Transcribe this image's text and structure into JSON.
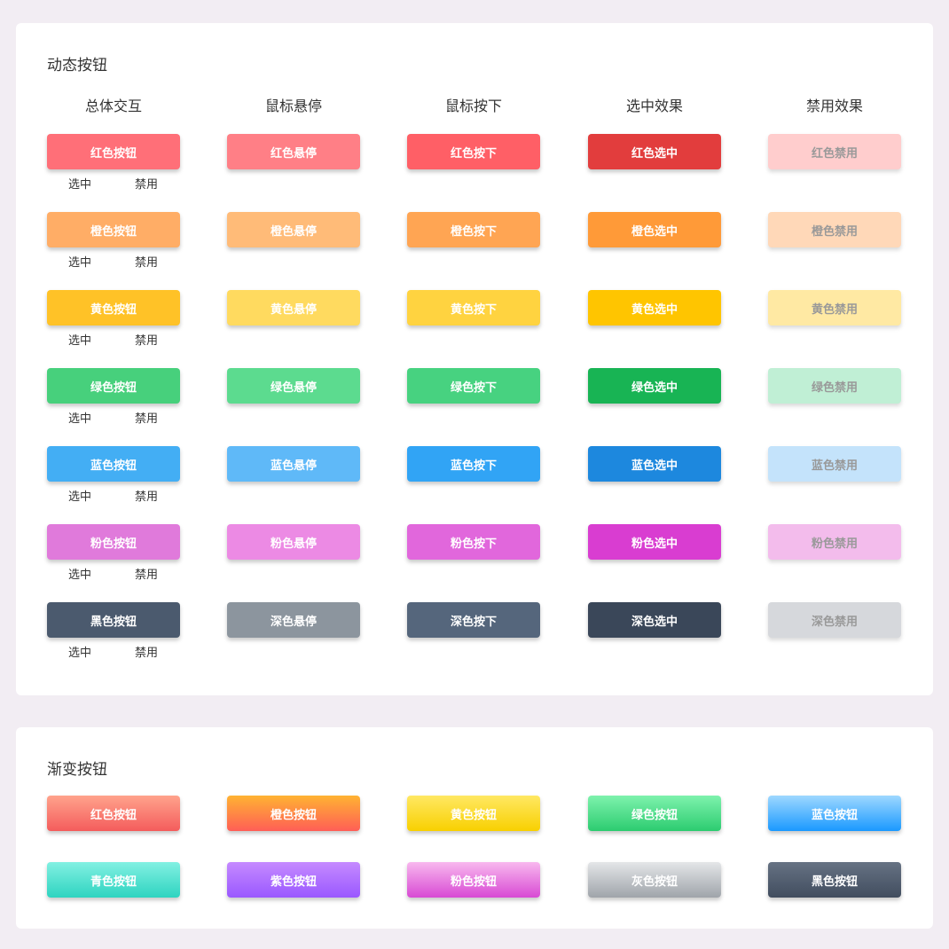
{
  "dynamic": {
    "title": "动态按钮",
    "headers": [
      "总体交互",
      "鼠标悬停",
      "鼠标按下",
      "选中效果",
      "禁用效果"
    ],
    "sub_selected": "选中",
    "sub_disabled": "禁用",
    "rows": [
      {
        "key": "red",
        "labels": [
          "红色按钮",
          "红色悬停",
          "红色按下",
          "红色选中",
          "红色禁用"
        ],
        "colors": [
          "#ff6f78",
          "#ff7f86",
          "#ff5f66",
          "#e23d3d",
          "#ffcdcd"
        ]
      },
      {
        "key": "orange",
        "labels": [
          "橙色按钮",
          "橙色悬停",
          "橙色按下",
          "橙色选中",
          "橙色禁用"
        ],
        "colors": [
          "#ffad66",
          "#ffbb78",
          "#ffa553",
          "#ff9a38",
          "#ffd8b8"
        ]
      },
      {
        "key": "yellow",
        "labels": [
          "黄色按钮",
          "黄色悬停",
          "黄色按下",
          "黄色选中",
          "黄色禁用"
        ],
        "colors": [
          "#ffc227",
          "#ffda5f",
          "#ffd340",
          "#ffc500",
          "#ffe9a3"
        ]
      },
      {
        "key": "green",
        "labels": [
          "绿色按钮",
          "绿色悬停",
          "绿色按下",
          "绿色选中",
          "绿色禁用"
        ],
        "colors": [
          "#47d07c",
          "#5cdb8f",
          "#47d280",
          "#18b454",
          "#c0efd5"
        ]
      },
      {
        "key": "blue",
        "labels": [
          "蓝色按钮",
          "蓝色悬停",
          "蓝色按下",
          "蓝色选中",
          "蓝色禁用"
        ],
        "colors": [
          "#43aef4",
          "#5fb9f8",
          "#31a4f5",
          "#1d88de",
          "#c4e3fb"
        ]
      },
      {
        "key": "pink",
        "labels": [
          "粉色按钮",
          "粉色悬停",
          "粉色按下",
          "粉色选中",
          "粉色禁用"
        ],
        "colors": [
          "#e07adb",
          "#ec8ae4",
          "#e167dc",
          "#d93dd1",
          "#f3bcec"
        ]
      },
      {
        "key": "dark",
        "labels": [
          "黑色按钮",
          "深色悬停",
          "深色按下",
          "深色选中",
          "深色禁用"
        ],
        "colors": [
          "#4b5a6e",
          "#8c959e",
          "#55667c",
          "#3a4759",
          "#d6d8dc"
        ]
      }
    ]
  },
  "gradient": {
    "title": "渐变按钮",
    "buttons": [
      {
        "label": "红色按钮",
        "from": "#ffa38c",
        "to": "#f45c5c"
      },
      {
        "label": "橙色按钮",
        "from": "#ffb332",
        "to": "#ff5e56"
      },
      {
        "label": "黄色按钮",
        "from": "#ffe863",
        "to": "#f8d000"
      },
      {
        "label": "绿色按钮",
        "from": "#7ef2ad",
        "to": "#2ccc70"
      },
      {
        "label": "蓝色按钮",
        "from": "#9ed8ff",
        "to": "#1a99ff"
      },
      {
        "label": "青色按钮",
        "from": "#82f0e2",
        "to": "#2ed4c0"
      },
      {
        "label": "紫色按钮",
        "from": "#c58aff",
        "to": "#9a58ff"
      },
      {
        "label": "粉色按钮",
        "from": "#f8b8ee",
        "to": "#d84ad4"
      },
      {
        "label": "灰色按钮",
        "from": "#e4e6e8",
        "to": "#9fa4aa"
      },
      {
        "label": "黑色按钮",
        "from": "#667283",
        "to": "#414d5f"
      }
    ]
  }
}
